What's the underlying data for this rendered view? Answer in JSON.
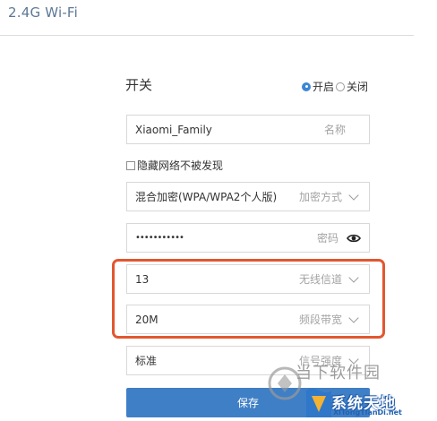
{
  "header": {
    "title": "2.4G Wi-Fi"
  },
  "switch": {
    "label": "开关",
    "options": [
      {
        "label": "开启",
        "checked": true
      },
      {
        "label": "关闭",
        "checked": false
      }
    ]
  },
  "ssid": {
    "value": "Xiaomi_Family",
    "hint": "名称"
  },
  "hide_network": {
    "label": "隐藏网络不被发现",
    "checked": false
  },
  "encryption": {
    "value": "混合加密(WPA/WPA2个人版)",
    "hint": "加密方式"
  },
  "password": {
    "value": "•••••••••••",
    "hint": "密码"
  },
  "channel": {
    "value": "13",
    "hint": "无线信道"
  },
  "bandwidth": {
    "value": "20M",
    "hint": "频段带宽"
  },
  "signal": {
    "value": "标准",
    "hint": "信号强度"
  },
  "save_label": "保存",
  "watermark": {
    "line1": "当下软件园",
    "line2": "系统天地",
    "line3": "XiTongTianDi.net"
  },
  "colors": {
    "accent": "#3f7fc6",
    "highlight": "#e2572f",
    "title": "#5d7896"
  }
}
